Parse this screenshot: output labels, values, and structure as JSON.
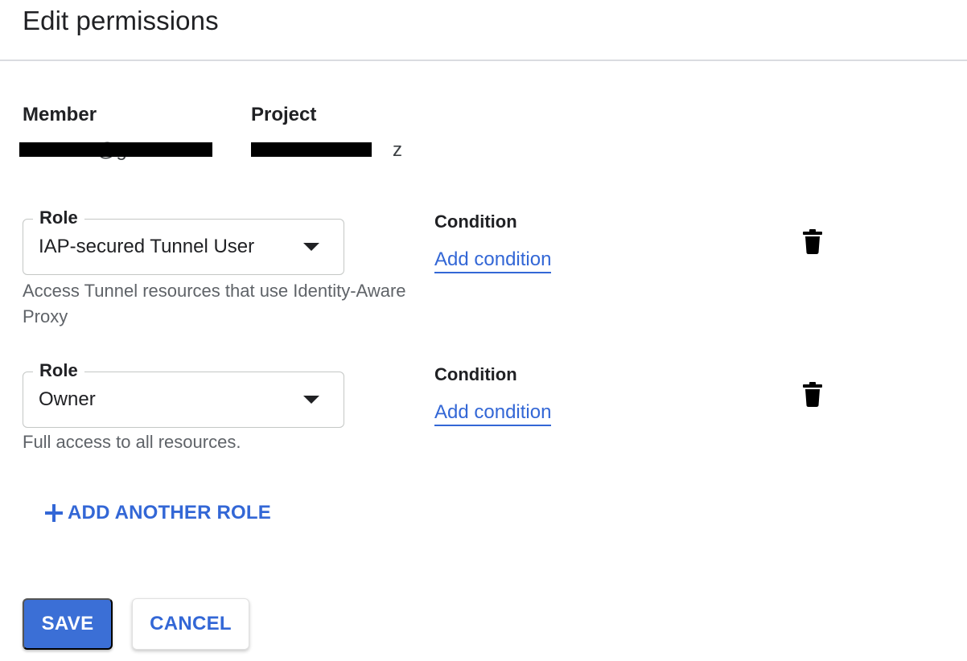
{
  "dialog": {
    "title": "Edit permissions"
  },
  "info": {
    "member_label": "Member",
    "member_value_visible": "@g",
    "project_label": "Project",
    "project_value_visible": "z"
  },
  "roles": [
    {
      "legend": "Role",
      "value": "IAP-secured Tunnel User",
      "description": "Access Tunnel resources that use Identity-Aware Proxy",
      "condition_label": "Condition",
      "add_condition_label": "Add condition"
    },
    {
      "legend": "Role",
      "value": "Owner",
      "description": "Full access to all resources.",
      "condition_label": "Condition",
      "add_condition_label": "Add condition"
    }
  ],
  "actions": {
    "add_role_label": "ADD ANOTHER ROLE",
    "save_label": "SAVE",
    "cancel_label": "CANCEL"
  },
  "icons": {
    "dropdown": "dropdown-arrow-icon",
    "delete": "trash-icon",
    "add": "plus-icon"
  },
  "colors": {
    "accent": "#3367d6",
    "save_button": "#3b6fd6",
    "text_primary": "#202124",
    "text_secondary": "#5f6368",
    "field_border": "#c4c7c5"
  }
}
